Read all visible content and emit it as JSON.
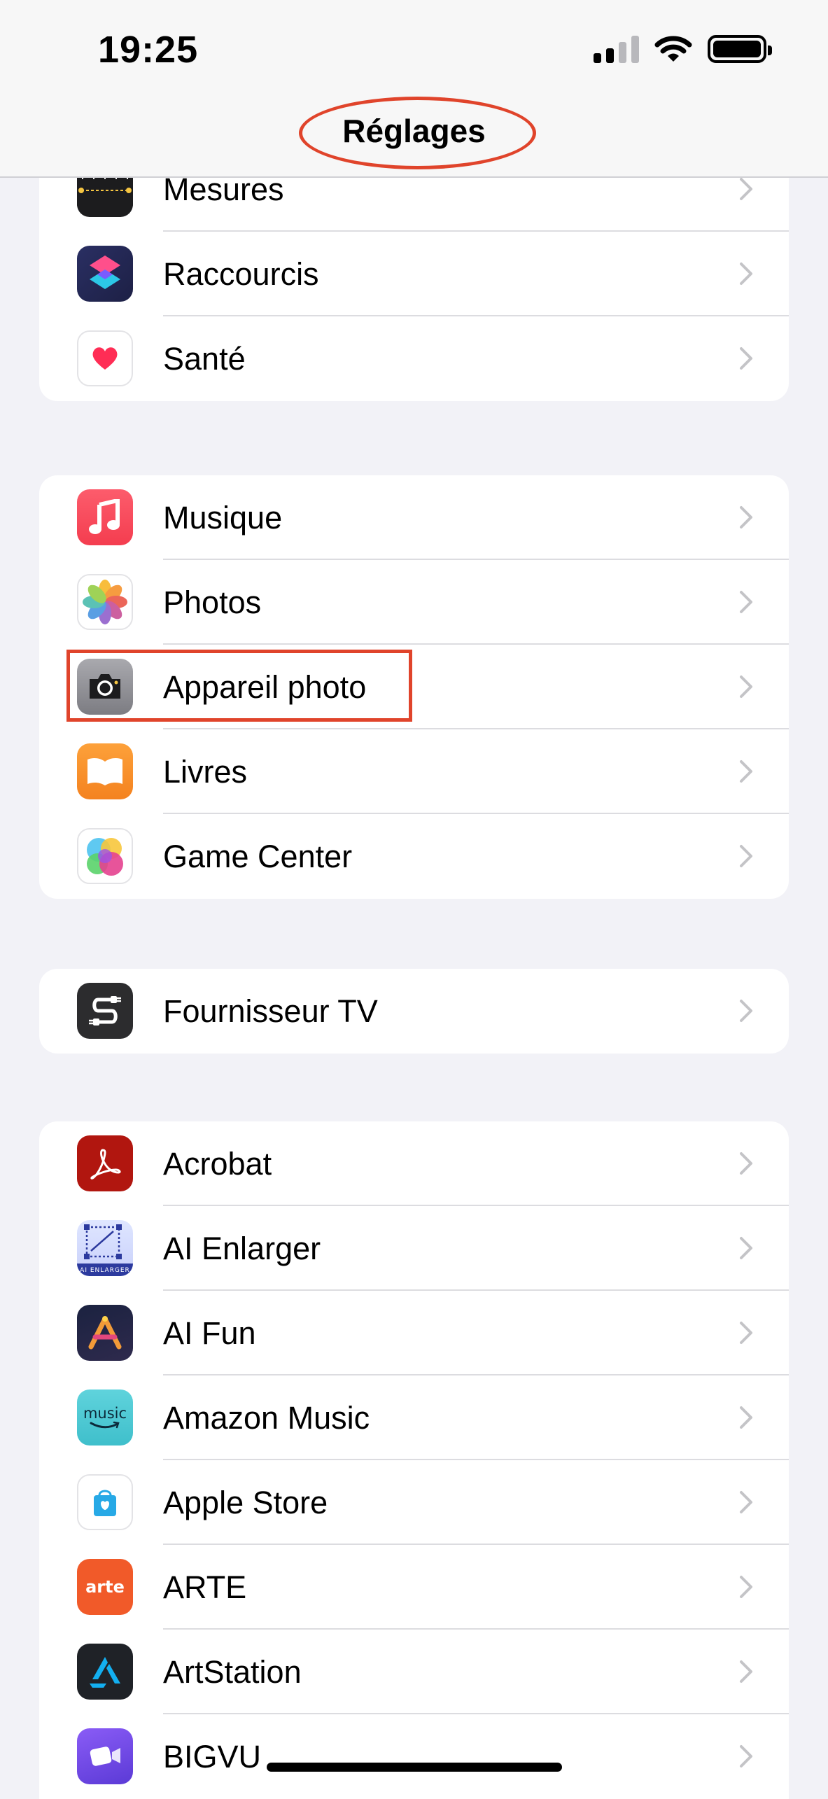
{
  "status_bar": {
    "time": "19:25"
  },
  "header": {
    "title": "Réglages"
  },
  "colors": {
    "highlight": "#e0442b",
    "background": "#f2f2f7",
    "chevron": "#c4c4c7"
  },
  "groups": [
    {
      "items": [
        {
          "label": "Mesures",
          "icon": "measure-icon"
        },
        {
          "label": "Raccourcis",
          "icon": "shortcuts-icon"
        },
        {
          "label": "Santé",
          "icon": "health-icon"
        }
      ]
    },
    {
      "items": [
        {
          "label": "Musique",
          "icon": "music-icon"
        },
        {
          "label": "Photos",
          "icon": "photos-icon"
        },
        {
          "label": "Appareil photo",
          "icon": "camera-icon"
        },
        {
          "label": "Livres",
          "icon": "books-icon"
        },
        {
          "label": "Game Center",
          "icon": "game-center-icon"
        }
      ]
    },
    {
      "items": [
        {
          "label": "Fournisseur TV",
          "icon": "tv-provider-icon"
        }
      ]
    },
    {
      "items": [
        {
          "label": "Acrobat",
          "icon": "acrobat-icon"
        },
        {
          "label": "AI Enlarger",
          "icon": "ai-enlarger-icon",
          "icon_text": "AI ENLARGER"
        },
        {
          "label": "AI Fun",
          "icon": "ai-fun-icon"
        },
        {
          "label": "Amazon Music",
          "icon": "amazon-music-icon",
          "icon_text": "music"
        },
        {
          "label": "Apple Store",
          "icon": "apple-store-icon"
        },
        {
          "label": "ARTE",
          "icon": "arte-icon",
          "icon_text": "arte"
        },
        {
          "label": "ArtStation",
          "icon": "artstation-icon"
        },
        {
          "label": "BIGVU",
          "icon": "bigvu-icon"
        }
      ]
    }
  ]
}
